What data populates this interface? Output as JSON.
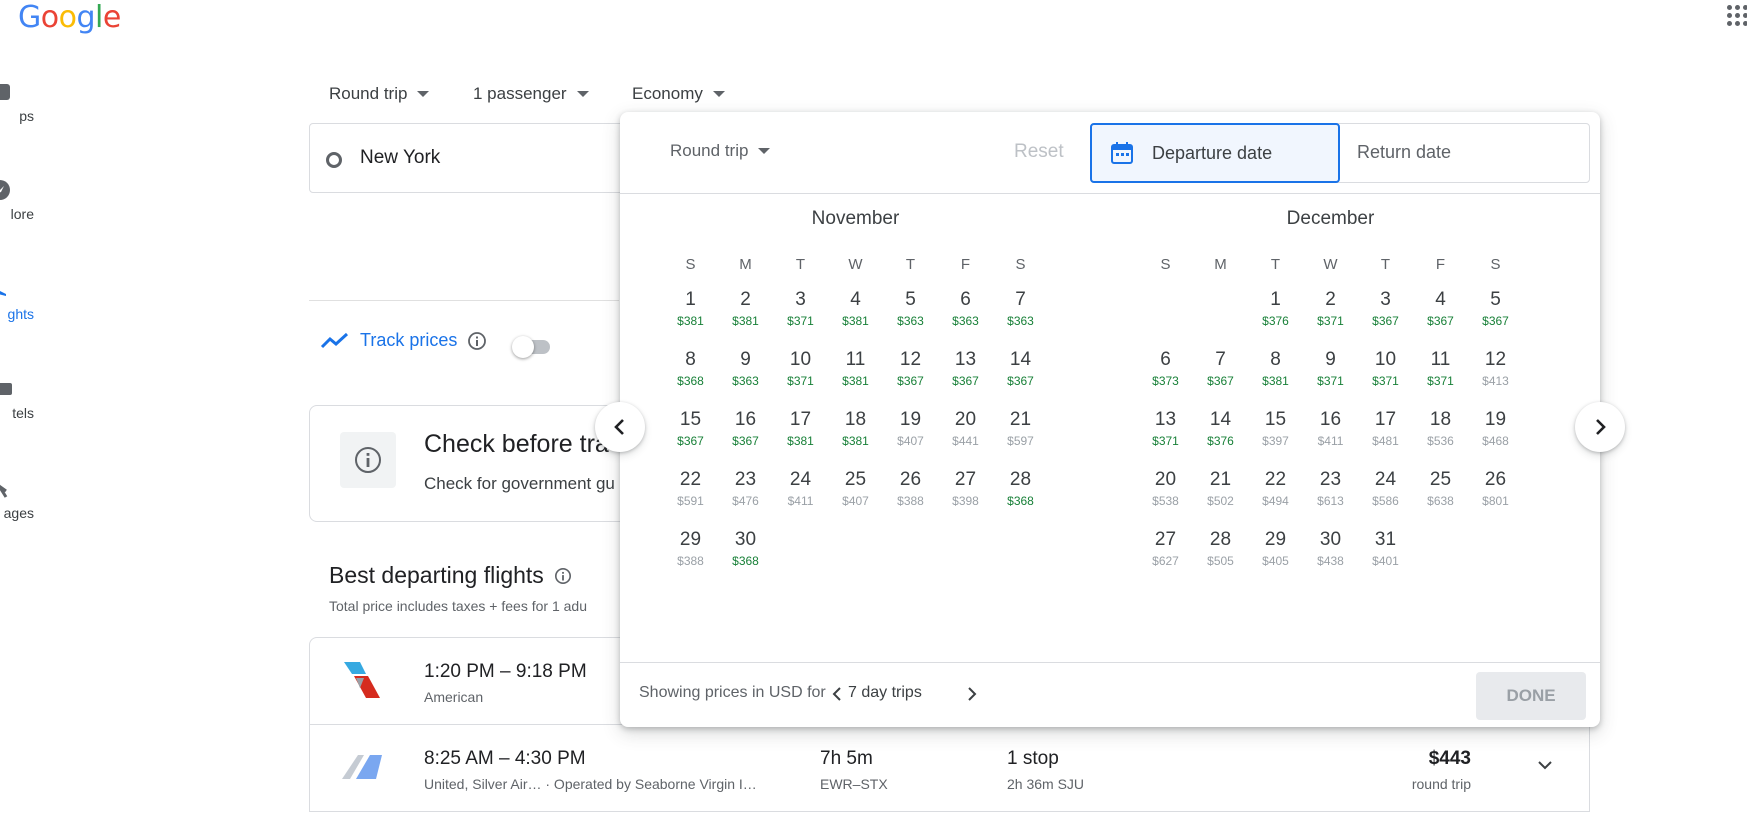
{
  "header": {
    "logo": "Google",
    "apps_icon": "apps-grid-icon"
  },
  "rail": [
    {
      "label": "ps",
      "icon": "trips-icon",
      "active": false
    },
    {
      "label": "lore",
      "icon": "explore-icon",
      "active": false
    },
    {
      "label": "ghts",
      "icon": "flights-icon",
      "active": true
    },
    {
      "label": "tels",
      "icon": "hotels-icon",
      "active": false
    },
    {
      "label": "ages",
      "icon": "packages-icon",
      "active": false
    }
  ],
  "search": {
    "trip_type": "Round trip",
    "passengers": "1 passenger",
    "cabin": "Economy",
    "from": "New York"
  },
  "track": {
    "label": "Track prices"
  },
  "check_card": {
    "title": "Check before tra",
    "subtitle": "Check for government gu"
  },
  "best": {
    "title": "Best departing flights",
    "subtitle": "Total price includes taxes + fees for 1 adu"
  },
  "flights": [
    {
      "times": "1:20 PM – 9:18 PM",
      "airline": "American",
      "duration": "",
      "route": "",
      "stops": "",
      "layover": "",
      "price": "",
      "price_type": ""
    },
    {
      "times": "8:25 AM – 4:30 PM",
      "airline": "United, Silver Air…   ·  Operated by Seaborne Virgin I…",
      "duration": "7h 5m",
      "route": "EWR–STX",
      "stops": "1 stop",
      "layover": "2h 36m SJU",
      "price": "$443",
      "price_type": "round trip"
    }
  ],
  "picker": {
    "trip_type": "Round trip",
    "reset": "Reset",
    "departure_placeholder": "Departure date",
    "return_placeholder": "Return date",
    "weekdays": [
      "S",
      "M",
      "T",
      "W",
      "T",
      "F",
      "S"
    ],
    "months": [
      {
        "name": "November",
        "offset": 0,
        "days": [
          {
            "d": "1",
            "p": "$381",
            "low": true
          },
          {
            "d": "2",
            "p": "$381",
            "low": true
          },
          {
            "d": "3",
            "p": "$371",
            "low": true
          },
          {
            "d": "4",
            "p": "$381",
            "low": true
          },
          {
            "d": "5",
            "p": "$363",
            "low": true
          },
          {
            "d": "6",
            "p": "$363",
            "low": true
          },
          {
            "d": "7",
            "p": "$363",
            "low": true
          },
          {
            "d": "8",
            "p": "$368",
            "low": true
          },
          {
            "d": "9",
            "p": "$363",
            "low": true
          },
          {
            "d": "10",
            "p": "$371",
            "low": true
          },
          {
            "d": "11",
            "p": "$381",
            "low": true
          },
          {
            "d": "12",
            "p": "$367",
            "low": true
          },
          {
            "d": "13",
            "p": "$367",
            "low": true
          },
          {
            "d": "14",
            "p": "$367",
            "low": true
          },
          {
            "d": "15",
            "p": "$367",
            "low": true
          },
          {
            "d": "16",
            "p": "$367",
            "low": true
          },
          {
            "d": "17",
            "p": "$381",
            "low": true
          },
          {
            "d": "18",
            "p": "$381",
            "low": true
          },
          {
            "d": "19",
            "p": "$407",
            "low": false
          },
          {
            "d": "20",
            "p": "$441",
            "low": false
          },
          {
            "d": "21",
            "p": "$597",
            "low": false
          },
          {
            "d": "22",
            "p": "$591",
            "low": false
          },
          {
            "d": "23",
            "p": "$476",
            "low": false
          },
          {
            "d": "24",
            "p": "$411",
            "low": false
          },
          {
            "d": "25",
            "p": "$407",
            "low": false
          },
          {
            "d": "26",
            "p": "$388",
            "low": false
          },
          {
            "d": "27",
            "p": "$398",
            "low": false
          },
          {
            "d": "28",
            "p": "$368",
            "low": true
          },
          {
            "d": "29",
            "p": "$388",
            "low": false
          },
          {
            "d": "30",
            "p": "$368",
            "low": true
          }
        ]
      },
      {
        "name": "December",
        "offset": 2,
        "days": [
          {
            "d": "1",
            "p": "$376",
            "low": true
          },
          {
            "d": "2",
            "p": "$371",
            "low": true
          },
          {
            "d": "3",
            "p": "$367",
            "low": true
          },
          {
            "d": "4",
            "p": "$367",
            "low": true
          },
          {
            "d": "5",
            "p": "$367",
            "low": true
          },
          {
            "d": "6",
            "p": "$373",
            "low": true
          },
          {
            "d": "7",
            "p": "$367",
            "low": true
          },
          {
            "d": "8",
            "p": "$381",
            "low": true
          },
          {
            "d": "9",
            "p": "$371",
            "low": true
          },
          {
            "d": "10",
            "p": "$371",
            "low": true
          },
          {
            "d": "11",
            "p": "$371",
            "low": true
          },
          {
            "d": "12",
            "p": "$413",
            "low": false
          },
          {
            "d": "13",
            "p": "$371",
            "low": true
          },
          {
            "d": "14",
            "p": "$376",
            "low": true
          },
          {
            "d": "15",
            "p": "$397",
            "low": false
          },
          {
            "d": "16",
            "p": "$411",
            "low": false
          },
          {
            "d": "17",
            "p": "$481",
            "low": false
          },
          {
            "d": "18",
            "p": "$536",
            "low": false
          },
          {
            "d": "19",
            "p": "$468",
            "low": false
          },
          {
            "d": "20",
            "p": "$538",
            "low": false
          },
          {
            "d": "21",
            "p": "$502",
            "low": false
          },
          {
            "d": "22",
            "p": "$494",
            "low": false
          },
          {
            "d": "23",
            "p": "$613",
            "low": false
          },
          {
            "d": "24",
            "p": "$586",
            "low": false
          },
          {
            "d": "25",
            "p": "$638",
            "low": false
          },
          {
            "d": "26",
            "p": "$801",
            "low": false
          },
          {
            "d": "27",
            "p": "$627",
            "low": false
          },
          {
            "d": "28",
            "p": "$505",
            "low": false
          },
          {
            "d": "29",
            "p": "$405",
            "low": false
          },
          {
            "d": "30",
            "p": "$438",
            "low": false
          },
          {
            "d": "31",
            "p": "$401",
            "low": false
          }
        ]
      }
    ],
    "footer_prefix": "Showing prices in USD for",
    "trip_length": "7 day trips",
    "done": "DONE"
  },
  "colors": {
    "accent": "#1a73e8",
    "low_price": "#188038",
    "normal_price": "#9aa0a6"
  }
}
